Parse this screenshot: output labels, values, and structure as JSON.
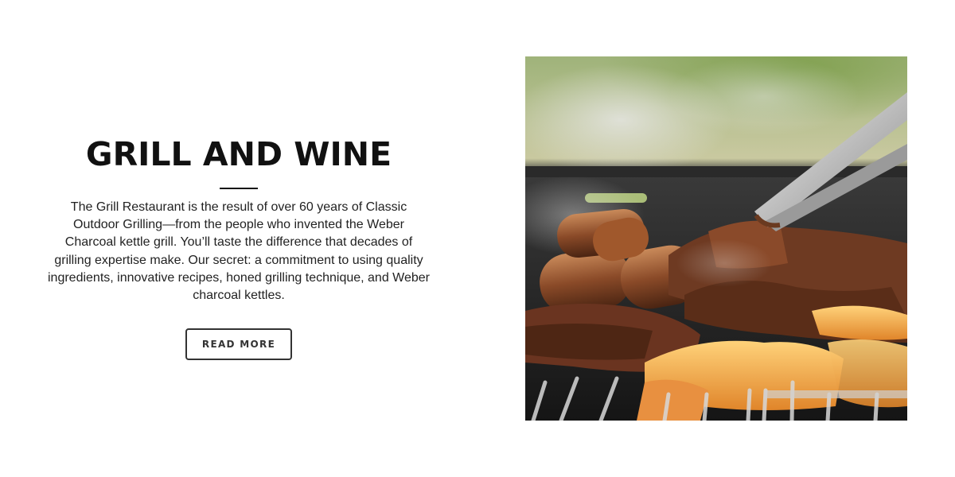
{
  "feature": {
    "title": "GRILL AND WINE",
    "description": "The Grill Restaurant is the result of over 60 years of Classic Outdoor Grilling—from the people who invented the Weber Charcoal kettle grill. You’ll taste the difference that decades of grilling expertise make. Our secret: a commitment to using quality ingredients, innovative recipes, honed grilling technique, and Weber charcoal kettles.",
    "button_label": "READ MORE"
  },
  "colors": {
    "text": "#111111",
    "button_border": "#333333",
    "background": "#ffffff"
  }
}
